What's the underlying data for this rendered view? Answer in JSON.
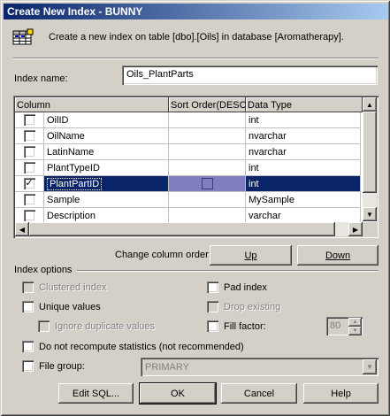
{
  "window": {
    "title": "Create New Index - BUNNY"
  },
  "description": "Create a new index on table [dbo].[Oils] in database [Aromatherapy].",
  "index_name": {
    "label": "Index name:",
    "value": "Oils_PlantParts"
  },
  "grid": {
    "headers": {
      "column": "Column",
      "sort": "Sort Order(DESC)",
      "type": "Data Type"
    },
    "rows": [
      {
        "name": "OilID",
        "type": "int",
        "checked": false,
        "selected": false
      },
      {
        "name": "OilName",
        "type": "nvarchar",
        "checked": false,
        "selected": false
      },
      {
        "name": "LatinName",
        "type": "nvarchar",
        "checked": false,
        "selected": false
      },
      {
        "name": "PlantTypeID",
        "type": "int",
        "checked": false,
        "selected": false
      },
      {
        "name": "PlantPartID",
        "type": "int",
        "checked": true,
        "selected": true
      },
      {
        "name": "Sample",
        "type": "MySample",
        "checked": false,
        "selected": false
      },
      {
        "name": "Description",
        "type": "varchar",
        "checked": false,
        "selected": false
      }
    ]
  },
  "column_order": {
    "label": "Change column order:",
    "up": "Up",
    "down": "Down"
  },
  "index_options": {
    "label": "Index options",
    "clustered": "Clustered index",
    "unique": "Unique values",
    "ignore_dup": "Ignore duplicate values",
    "pad_index": "Pad index",
    "drop_existing": "Drop existing",
    "fill_factor": "Fill factor:",
    "fill_value": "80",
    "no_recompute": "Do not recompute statistics (not recommended)",
    "file_group": "File group:",
    "file_group_value": "PRIMARY"
  },
  "buttons": {
    "edit_sql": "Edit SQL...",
    "ok": "OK",
    "cancel": "Cancel",
    "help": "Help"
  },
  "colors": {
    "title_start": "#0a246a",
    "title_end": "#a6caf0",
    "face": "#d4d0c8",
    "selection": "#0a246a"
  }
}
